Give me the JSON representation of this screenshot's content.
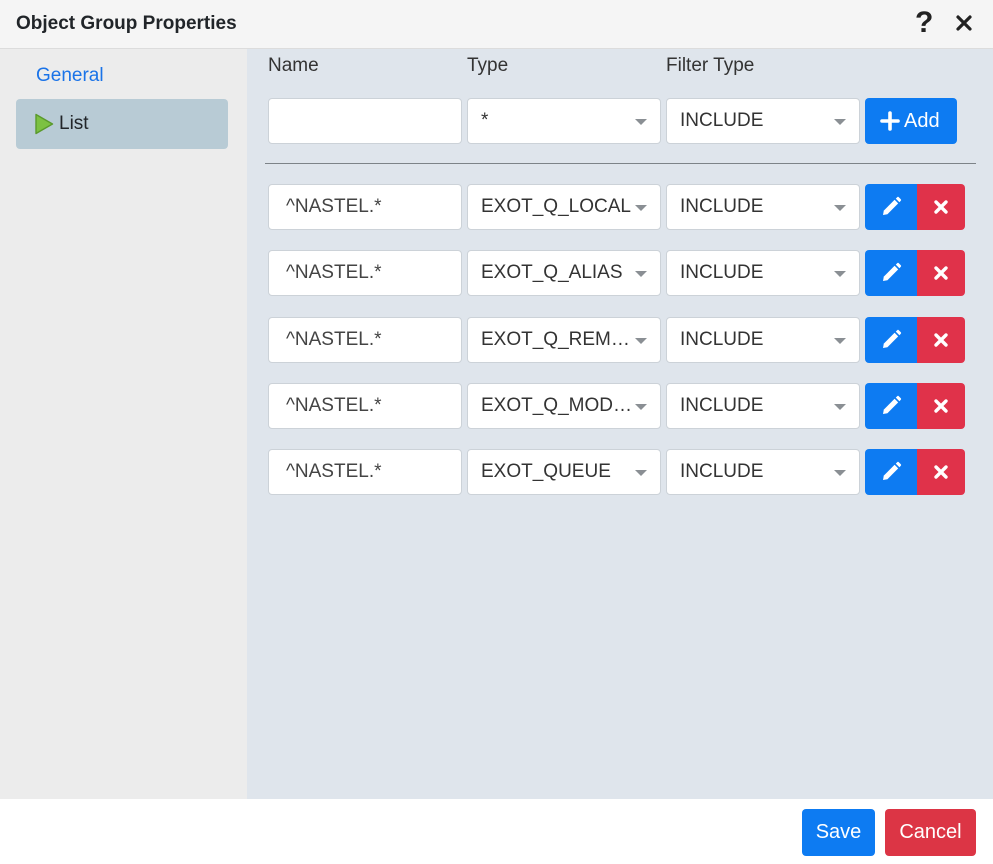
{
  "dialog": {
    "title": "Object Group Properties",
    "help_symbol": "?"
  },
  "sidebar": {
    "items": [
      {
        "label": "General"
      },
      {
        "label": "List"
      }
    ]
  },
  "columns": {
    "name": "Name",
    "type": "Type",
    "filter_type": "Filter Type"
  },
  "new_entry": {
    "name_value": "",
    "type_value": "*",
    "filter_value": "INCLUDE",
    "add_label": "Add"
  },
  "rows": [
    {
      "name": "^NASTEL.*",
      "type": "EXOT_Q_LOCAL",
      "filter": "INCLUDE"
    },
    {
      "name": "^NASTEL.*",
      "type": "EXOT_Q_ALIAS",
      "filter": "INCLUDE"
    },
    {
      "name": "^NASTEL.*",
      "type": "EXOT_Q_REMOTE",
      "filter": "INCLUDE"
    },
    {
      "name": "^NASTEL.*",
      "type": "EXOT_Q_MODEL",
      "filter": "INCLUDE"
    },
    {
      "name": "^NASTEL.*",
      "type": "EXOT_QUEUE",
      "filter": "INCLUDE"
    }
  ],
  "footer": {
    "save_label": "Save",
    "cancel_label": "Cancel"
  },
  "colors": {
    "primary": "#0d7bf2",
    "danger": "#e0324a",
    "sidebar_active": "#b8cbd5",
    "play_icon": "#7cc142"
  }
}
